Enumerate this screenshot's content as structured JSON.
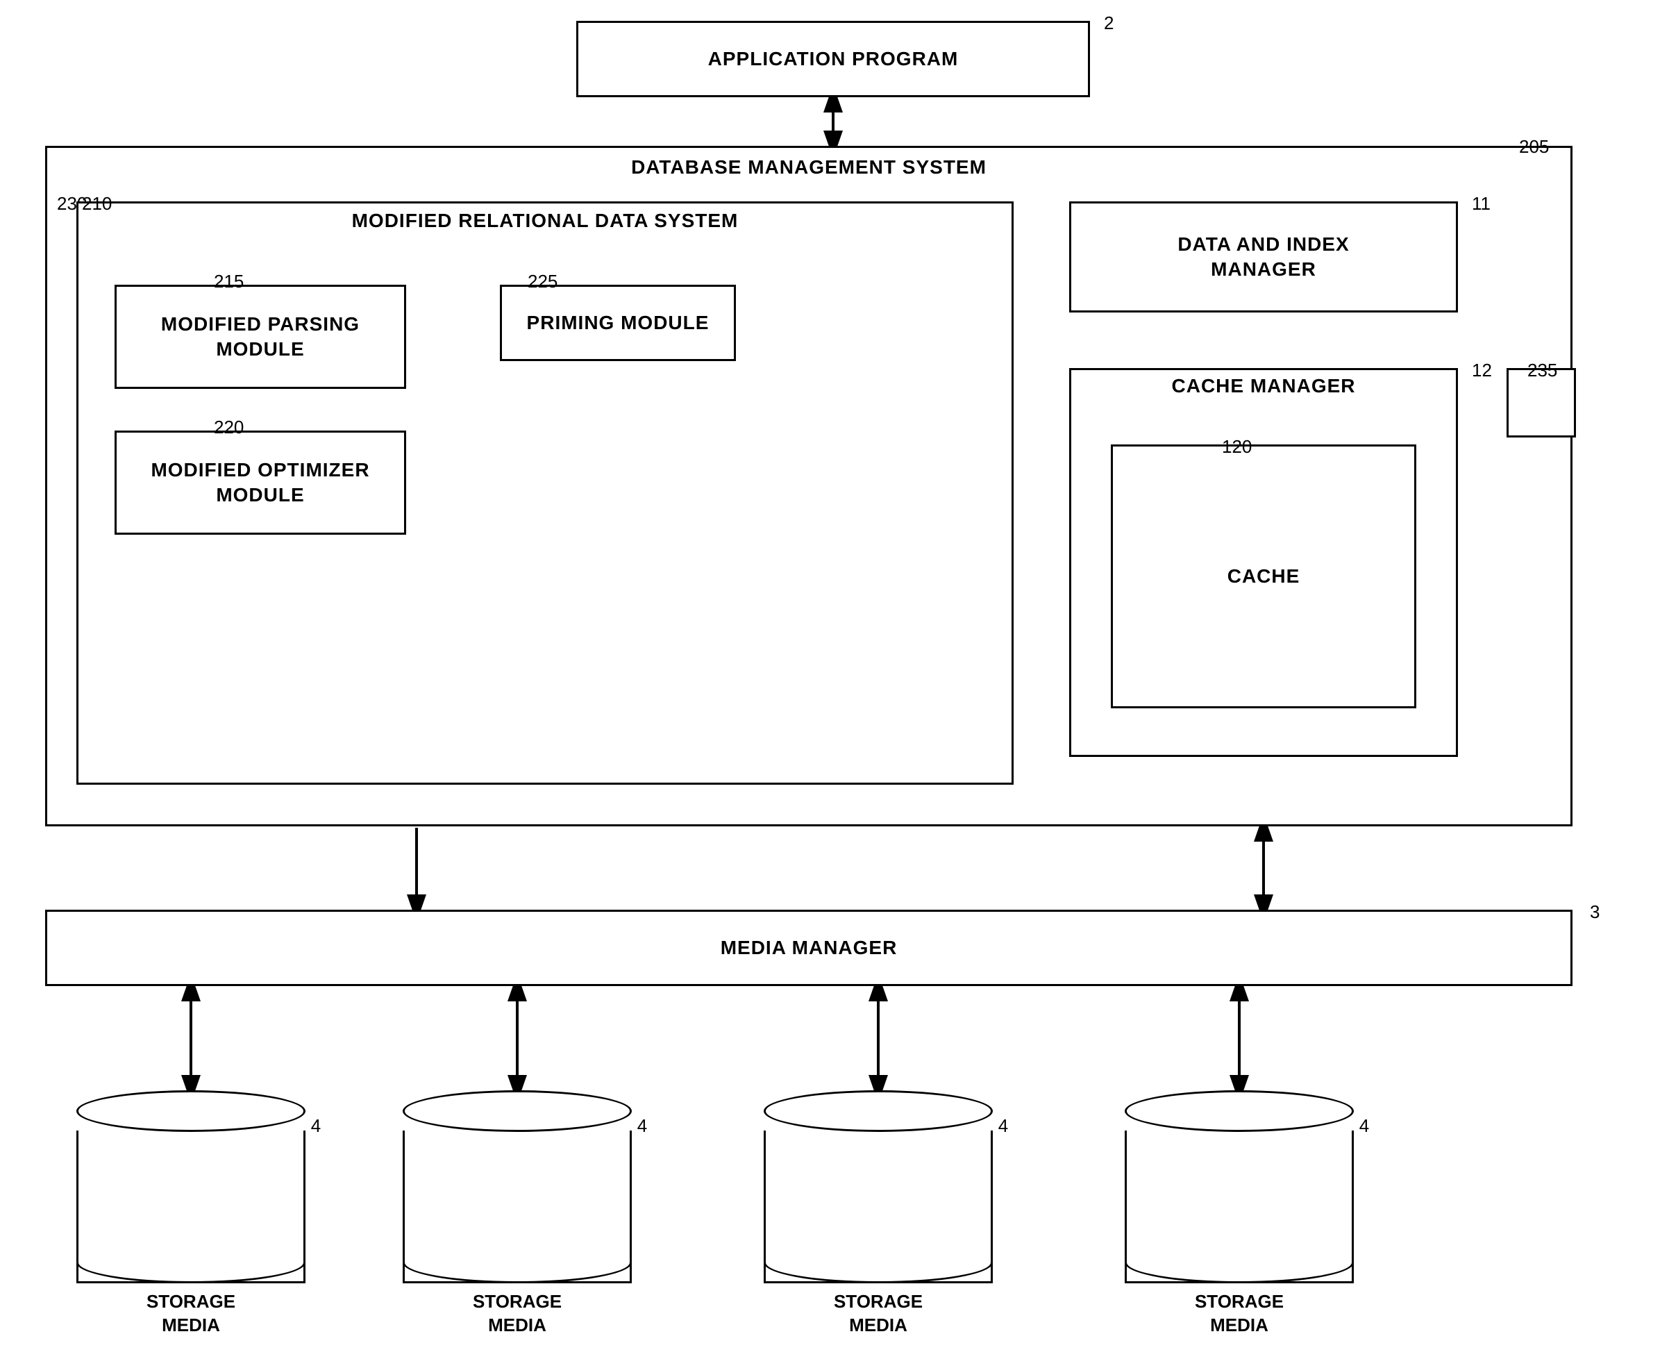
{
  "labels": {
    "app_program": "APPLICATION PROGRAM",
    "dbms": "DATABASE MANAGEMENT SYSTEM",
    "mrds": "MODIFIED RELATIONAL DATA SYSTEM",
    "parsing_module": "MODIFIED PARSING\nMODULE",
    "parsing_module_line1": "MODIFIED PARSING",
    "parsing_module_line2": "MODULE",
    "priming_module": "PRIMING MODULE",
    "optimizer_module": "MODIFIED OPTIMIZER\nMODULE",
    "optimizer_module_line1": "MODIFIED OPTIMIZER",
    "optimizer_module_line2": "MODULE",
    "data_index_manager_line1": "DATA AND INDEX",
    "data_index_manager_line2": "MANAGER",
    "cache_manager": "CACHE MANAGER",
    "cache": "CACHE",
    "media_manager": "MEDIA MANAGER",
    "storage_media": "STORAGE\nMEDIA",
    "storage_media_line1": "STORAGE",
    "storage_media_line2": "MEDIA"
  },
  "ref_numbers": {
    "r2": "2",
    "r3": "3",
    "r4a": "4",
    "r4b": "4",
    "r4c": "4",
    "r4d": "4",
    "r11": "11",
    "r12": "12",
    "r120": "120",
    "r205": "205",
    "r210": "210",
    "r215": "215",
    "r220": "220",
    "r225": "225",
    "r230": "230",
    "r235": "235"
  },
  "colors": {
    "border": "#000000",
    "background": "#ffffff",
    "text": "#000000"
  }
}
